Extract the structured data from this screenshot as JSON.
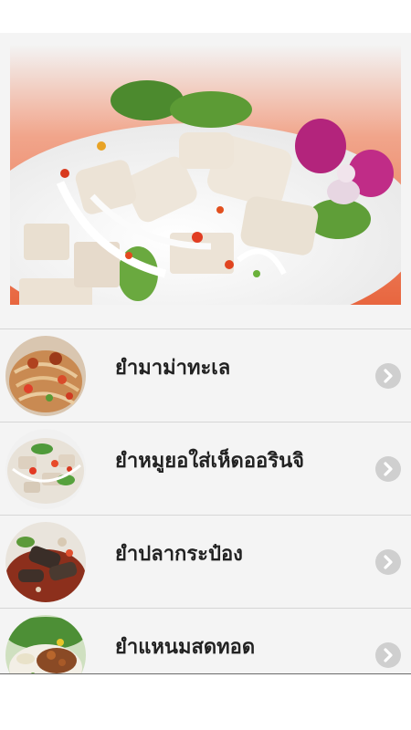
{
  "hero": {
    "icon": "spicy-sausage-salad-photo"
  },
  "menu": {
    "items": [
      {
        "label": "ยำมาม่าทะเล",
        "icon": "seafood-noodle-salad-photo"
      },
      {
        "label": "ยำหมูยอใส่เห็ดออรินจิ",
        "icon": "pork-sausage-mushroom-salad-photo"
      },
      {
        "label": "ยำปลากระป๋อง",
        "icon": "canned-fish-salad-photo"
      },
      {
        "label": "ยำแหนมสดทอด",
        "icon": "fried-fermented-pork-salad-photo"
      }
    ],
    "chevron_icon": "chevron-right-icon"
  },
  "colors": {
    "background": "#f4f4f4",
    "divider": "#d6d6d6",
    "title_text": "#222222",
    "chevron_circle": "#cfcfcf"
  }
}
